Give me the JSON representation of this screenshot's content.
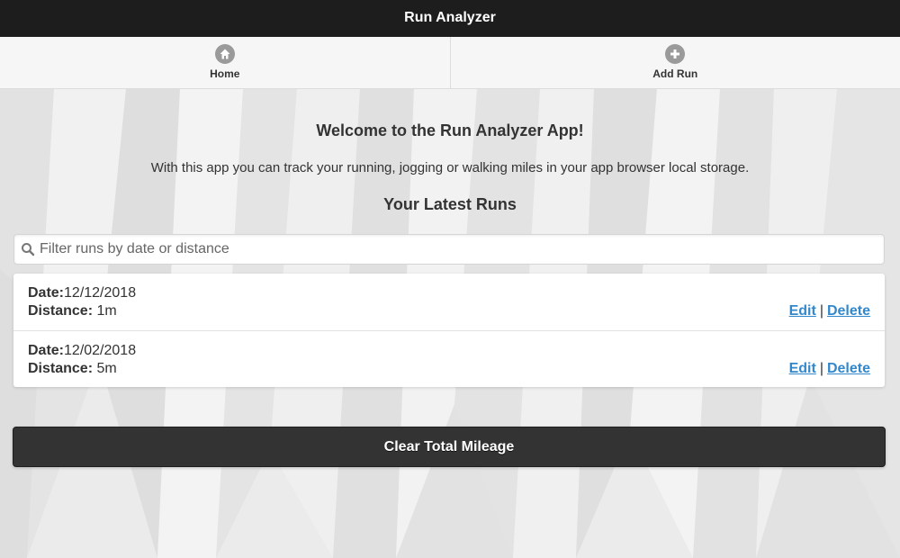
{
  "header": {
    "title": "Run Analyzer"
  },
  "nav": {
    "items": [
      {
        "label": "Home",
        "icon": "home-icon"
      },
      {
        "label": "Add Run",
        "icon": "plus-icon"
      }
    ]
  },
  "main": {
    "welcome": "Welcome to the Run Analyzer App!",
    "intro": "With this app you can track your running, jogging or walking miles in your app browser local storage.",
    "runs_title": "Your Latest Runs"
  },
  "search": {
    "placeholder": "Filter runs by date or distance",
    "value": ""
  },
  "runs": {
    "date_label": "Date:",
    "distance_label": "Distance:",
    "edit_label": "Edit",
    "delete_label": "Delete",
    "separator": "|",
    "items": [
      {
        "date": "12/12/2018",
        "distance": "1m"
      },
      {
        "date": "12/02/2018",
        "distance": "5m"
      }
    ]
  },
  "clear_button": {
    "label": "Clear Total Mileage"
  },
  "colors": {
    "header_bg": "#1d1d1d",
    "link": "#3388cc",
    "button_bg": "#333333",
    "icon_gray": "#9a9a9a"
  }
}
